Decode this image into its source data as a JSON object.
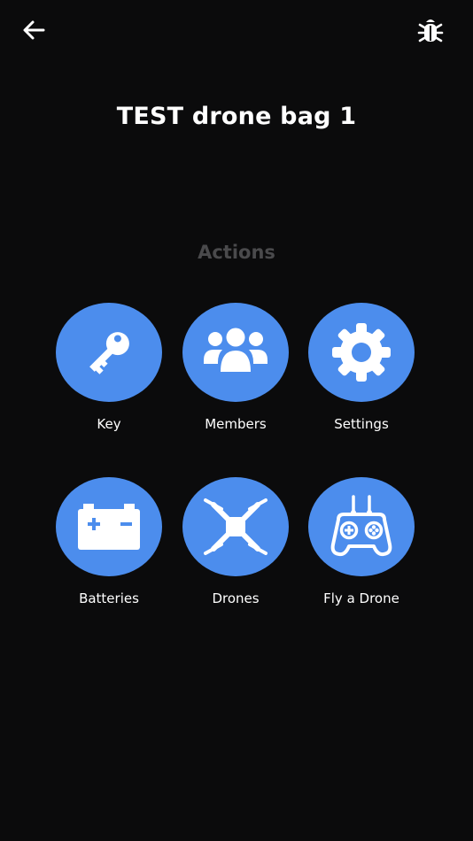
{
  "header": {
    "back_icon": "arrow-left-icon",
    "debug_icon": "bug-icon",
    "title": "TEST drone bag 1"
  },
  "actions": {
    "heading": "Actions",
    "items": [
      {
        "label": "Key",
        "icon": "key-icon"
      },
      {
        "label": "Members",
        "icon": "users-icon"
      },
      {
        "label": "Settings",
        "icon": "gear-icon"
      },
      {
        "label": "Batteries",
        "icon": "car-battery-icon"
      },
      {
        "label": "Drones",
        "icon": "drone-icon"
      },
      {
        "label": "Fly a Drone",
        "icon": "gamepad-controller-icon"
      }
    ]
  },
  "colors": {
    "background": "#0b0b0c",
    "accent": "#4c8ded",
    "heading_muted": "#4a4a4c",
    "text": "#ffffff"
  }
}
